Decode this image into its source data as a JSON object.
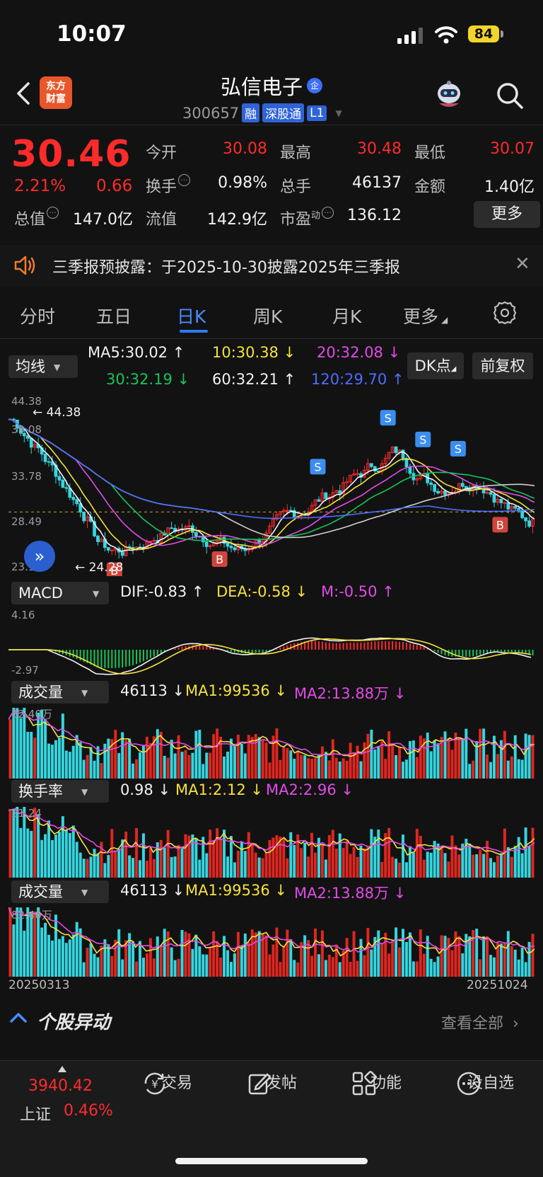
{
  "status": {
    "time": "10:07",
    "battery": "84"
  },
  "header": {
    "logo_line1": "东方",
    "logo_line2": "财富",
    "stock_name": "弘信电子",
    "name_badge": "企",
    "stock_code": "300657",
    "tags": [
      "融",
      "深股通",
      "L1"
    ]
  },
  "quote": {
    "price": "30.46",
    "change_pct": "2.21%",
    "change": "0.66",
    "open_label": "今开",
    "open": "30.08",
    "high_label": "最高",
    "high": "30.48",
    "low_label": "最低",
    "low": "30.07",
    "turnover_label": "换手",
    "turnover": "0.98%",
    "volume_label": "总手",
    "volume": "46137",
    "amount_label": "金额",
    "amount": "1.40亿",
    "mcap_label": "总值",
    "mcap": "147.0亿",
    "float_label": "流值",
    "float": "142.9亿",
    "pe_label": "市盈",
    "pe_sup": "动",
    "pe": "136.12",
    "more_label": "更多"
  },
  "notice": {
    "text": "三季报预披露：于2025-10-30披露2025年三季报"
  },
  "tabs": [
    "分时",
    "五日",
    "日K",
    "周K",
    "月K",
    "更多"
  ],
  "ma": {
    "selector": "均线",
    "ma5": "MA5:30.02",
    "ma10": "10:30.38",
    "ma20": "20:32.08",
    "ma30": "30:32.19",
    "ma60": "60:32.21",
    "ma120": "120:29.70",
    "dk_label": "DK点",
    "adjust_label": "前复权",
    "y_high": "44.38",
    "y_mid1": "39.08",
    "y_mid2": "33.78",
    "y_mid3": "28.49",
    "y_low": "23.19",
    "max_label": "44.38",
    "min_label": "24.28"
  },
  "macd": {
    "selector": "MACD",
    "dif": "DIF:-0.83",
    "dea": "DEA:-0.58",
    "m": "M:-0.50",
    "y_top": "4.16",
    "y_bottom": "-2.97"
  },
  "volume": {
    "selector": "成交量",
    "val": "46113",
    "ma1": "MA1:99536",
    "ma2": "MA2:13.88万",
    "y_top": "82.40万"
  },
  "turnover_panel": {
    "selector": "换手率",
    "val": "0.98",
    "ma1": "MA1:2.12",
    "ma2": "MA2:2.96",
    "y_top": "21.24"
  },
  "volume2": {
    "selector": "成交量",
    "val": "46113",
    "ma1": "MA1:99536",
    "ma2": "MA2:13.88万",
    "y_top": "82.40万",
    "date_start": "20250313",
    "date_end": "20251024"
  },
  "section": {
    "title": "个股异动",
    "view_all": "查看全部"
  },
  "bottom_nav": {
    "index_value": "3940.42",
    "index_name": "上证",
    "index_pct": "0.46%",
    "items": [
      "交易",
      "发帖",
      "功能",
      "设自选"
    ]
  },
  "colors": {
    "up": "#ff2b2b",
    "down": "#19c35a",
    "accent": "#2f78ff",
    "cyan": "#34d6e0"
  },
  "icons": [
    "back-icon",
    "robot-icon",
    "search-icon",
    "speaker-icon",
    "close-icon",
    "settings-icon",
    "chevron-right-icon",
    "trade-icon",
    "post-icon",
    "function-icon",
    "watchlist-icon"
  ]
}
